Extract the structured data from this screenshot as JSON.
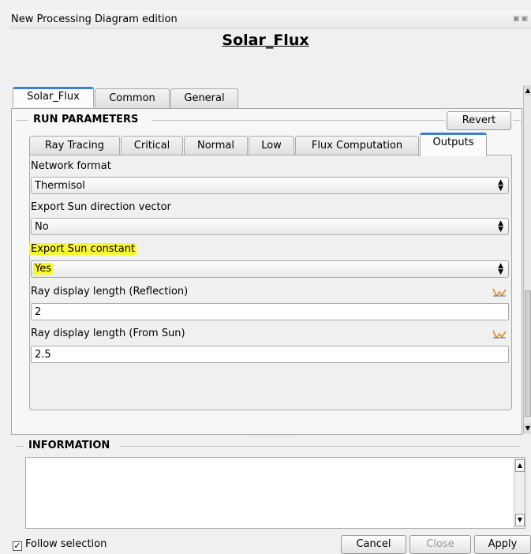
{
  "window": {
    "title": "New Processing Diagram edition",
    "controls_icon": "dock-float-icon"
  },
  "main_title": "Solar_Flux",
  "outer_tabs": [
    {
      "label": "Solar_Flux",
      "active": true
    },
    {
      "label": "Common",
      "active": false
    },
    {
      "label": "General",
      "active": false
    }
  ],
  "run_parameters": {
    "title": "RUN PARAMETERS",
    "revert_label": "Revert",
    "tabs": [
      {
        "label": "Ray Tracing",
        "active": false
      },
      {
        "label": "Critical",
        "active": false
      },
      {
        "label": "Normal",
        "active": false
      },
      {
        "label": "Low",
        "active": false
      },
      {
        "label": "Flux Computation",
        "active": false
      },
      {
        "label": "Outputs",
        "active": true
      }
    ],
    "fields": {
      "network_format": {
        "label": "Network format",
        "value": "Thermisol"
      },
      "export_sun_direction": {
        "label": "Export Sun direction vector",
        "value": "No"
      },
      "export_sun_constant": {
        "label": "Export Sun constant",
        "value": "Yes",
        "highlight": "#f7f733"
      },
      "ray_len_reflection": {
        "label": "Ray display length (Reflection)",
        "value": "2"
      },
      "ray_len_sun": {
        "label": "Ray display length (From Sun)",
        "value": "2.5"
      }
    }
  },
  "information": {
    "title": "INFORMATION",
    "content": ""
  },
  "footer": {
    "follow_selection_label": "Follow selection",
    "follow_selection_checked": true,
    "cancel_label": "Cancel",
    "close_label": "Close",
    "apply_label": "Apply"
  },
  "colors": {
    "active_tab_accent": "#3f7fcf",
    "highlight": "#f7f733",
    "graph_icon": "#e58a1a"
  }
}
